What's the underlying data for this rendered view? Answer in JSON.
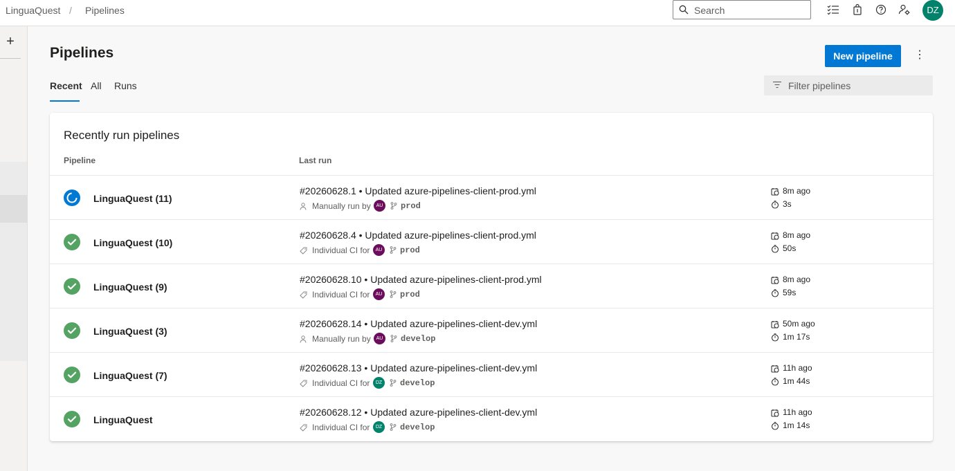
{
  "breadcrumb": {
    "project": "LinguaQuest",
    "separator": "/",
    "page": "Pipelines"
  },
  "search": {
    "placeholder": "Search"
  },
  "user": {
    "initials": "DZ"
  },
  "header": {
    "title": "Pipelines",
    "new_button": "New pipeline",
    "more": "⋮"
  },
  "tabs": [
    {
      "label": "Recent"
    },
    {
      "label": "All"
    },
    {
      "label": "Runs"
    }
  ],
  "filter": {
    "placeholder": "Filter pipelines"
  },
  "card": {
    "title": "Recently run pipelines",
    "col_pipeline": "Pipeline",
    "col_last_run": "Last run"
  },
  "colors": {
    "accent": "#0078d4",
    "success": "#55a362",
    "avatar_au": "#6b0d5c",
    "avatar_dz": "#00826b"
  },
  "rows": [
    {
      "status": "running",
      "name": "LinguaQuest (11)",
      "run": "#20260628.1 • Updated azure-pipelines-client-prod.yml",
      "trigger_icon": "person-icon",
      "trigger": "Manually run by",
      "avatar": "AU",
      "branch": "prod",
      "ago": "8m ago",
      "duration": "3s"
    },
    {
      "status": "success",
      "name": "LinguaQuest (10)",
      "run": "#20260628.4 • Updated azure-pipelines-client-prod.yml",
      "trigger_icon": "tag-icon",
      "trigger": "Individual CI for",
      "avatar": "AU",
      "branch": "prod",
      "ago": "8m ago",
      "duration": "50s"
    },
    {
      "status": "success",
      "name": "LinguaQuest (9)",
      "run": "#20260628.10 • Updated azure-pipelines-client-prod.yml",
      "trigger_icon": "tag-icon",
      "trigger": "Individual CI for",
      "avatar": "AU",
      "branch": "prod",
      "ago": "8m ago",
      "duration": "59s"
    },
    {
      "status": "success",
      "name": "LinguaQuest (3)",
      "run": "#20260628.14 • Updated azure-pipelines-client-dev.yml",
      "trigger_icon": "person-icon",
      "trigger": "Manually run by",
      "avatar": "AU",
      "branch": "develop",
      "ago": "50m ago",
      "duration": "1m 17s"
    },
    {
      "status": "success",
      "name": "LinguaQuest (7)",
      "run": "#20260628.13 • Updated azure-pipelines-client-dev.yml",
      "trigger_icon": "tag-icon",
      "trigger": "Individual CI for",
      "avatar": "DZ",
      "branch": "develop",
      "ago": "11h ago",
      "duration": "1m 44s"
    },
    {
      "status": "success",
      "name": "LinguaQuest",
      "run": "#20260628.12 • Updated azure-pipelines-client-dev.yml",
      "trigger_icon": "tag-icon",
      "trigger": "Individual CI for",
      "avatar": "DZ",
      "branch": "develop",
      "ago": "11h ago",
      "duration": "1m 14s"
    }
  ]
}
